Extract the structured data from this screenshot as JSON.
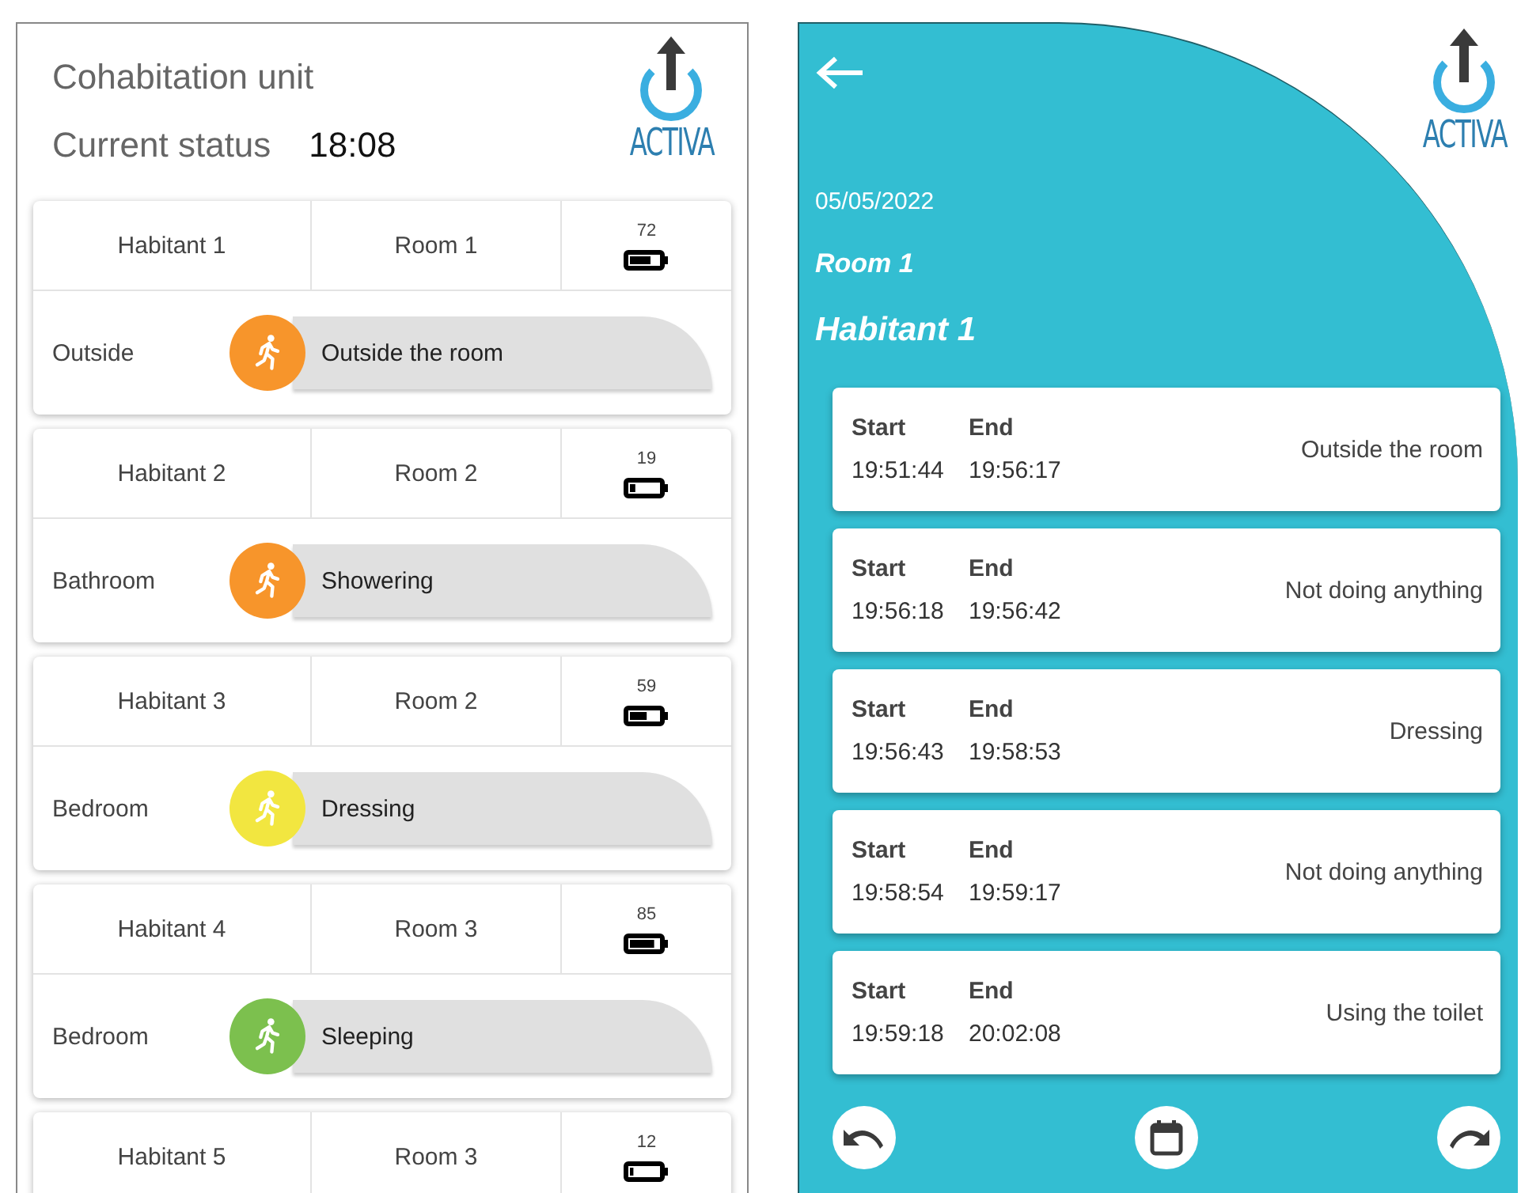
{
  "cohabitation": {
    "title": "Cohabitation unit",
    "status_label": "Current status",
    "time": "18:08",
    "logo": "ACTIVA",
    "habitants": [
      {
        "name": "Habitant 1",
        "room": "Room 1",
        "battery": "72",
        "location": "Outside",
        "activity": "Outside the room",
        "color": "#f7952b"
      },
      {
        "name": "Habitant 2",
        "room": "Room 2",
        "battery": "19",
        "location": "Bathroom",
        "activity": "Showering",
        "color": "#f7952b"
      },
      {
        "name": "Habitant 3",
        "room": "Room 2",
        "battery": "59",
        "location": "Bedroom",
        "activity": "Dressing",
        "color": "#f2e640"
      },
      {
        "name": "Habitant 4",
        "room": "Room 3",
        "battery": "85",
        "location": "Bedroom",
        "activity": "Sleeping",
        "color": "#7cc04e"
      },
      {
        "name": "Habitant 5",
        "room": "Room 3",
        "battery": "12"
      }
    ]
  },
  "detail": {
    "logo": "ACTIVA",
    "date": "05/05/2022",
    "room": "Room 1",
    "habitant": "Habitant 1",
    "entries": [
      {
        "start_label": "Start",
        "end_label": "End",
        "start": "19:51:44",
        "end": "19:56:17",
        "activity": "Outside the room"
      },
      {
        "start_label": "Start",
        "end_label": "End",
        "start": "19:56:18",
        "end": "19:56:42",
        "activity": "Not doing anything"
      },
      {
        "start_label": "Start",
        "end_label": "End",
        "start": "19:56:43",
        "end": "19:58:53",
        "activity": "Dressing"
      },
      {
        "start_label": "Start",
        "end_label": "End",
        "start": "19:58:54",
        "end": "19:59:17",
        "activity": "Not doing anything"
      },
      {
        "start_label": "Start",
        "end_label": "End",
        "start": "19:59:18",
        "end": "20:02:08",
        "activity": "Using the toilet"
      }
    ]
  }
}
